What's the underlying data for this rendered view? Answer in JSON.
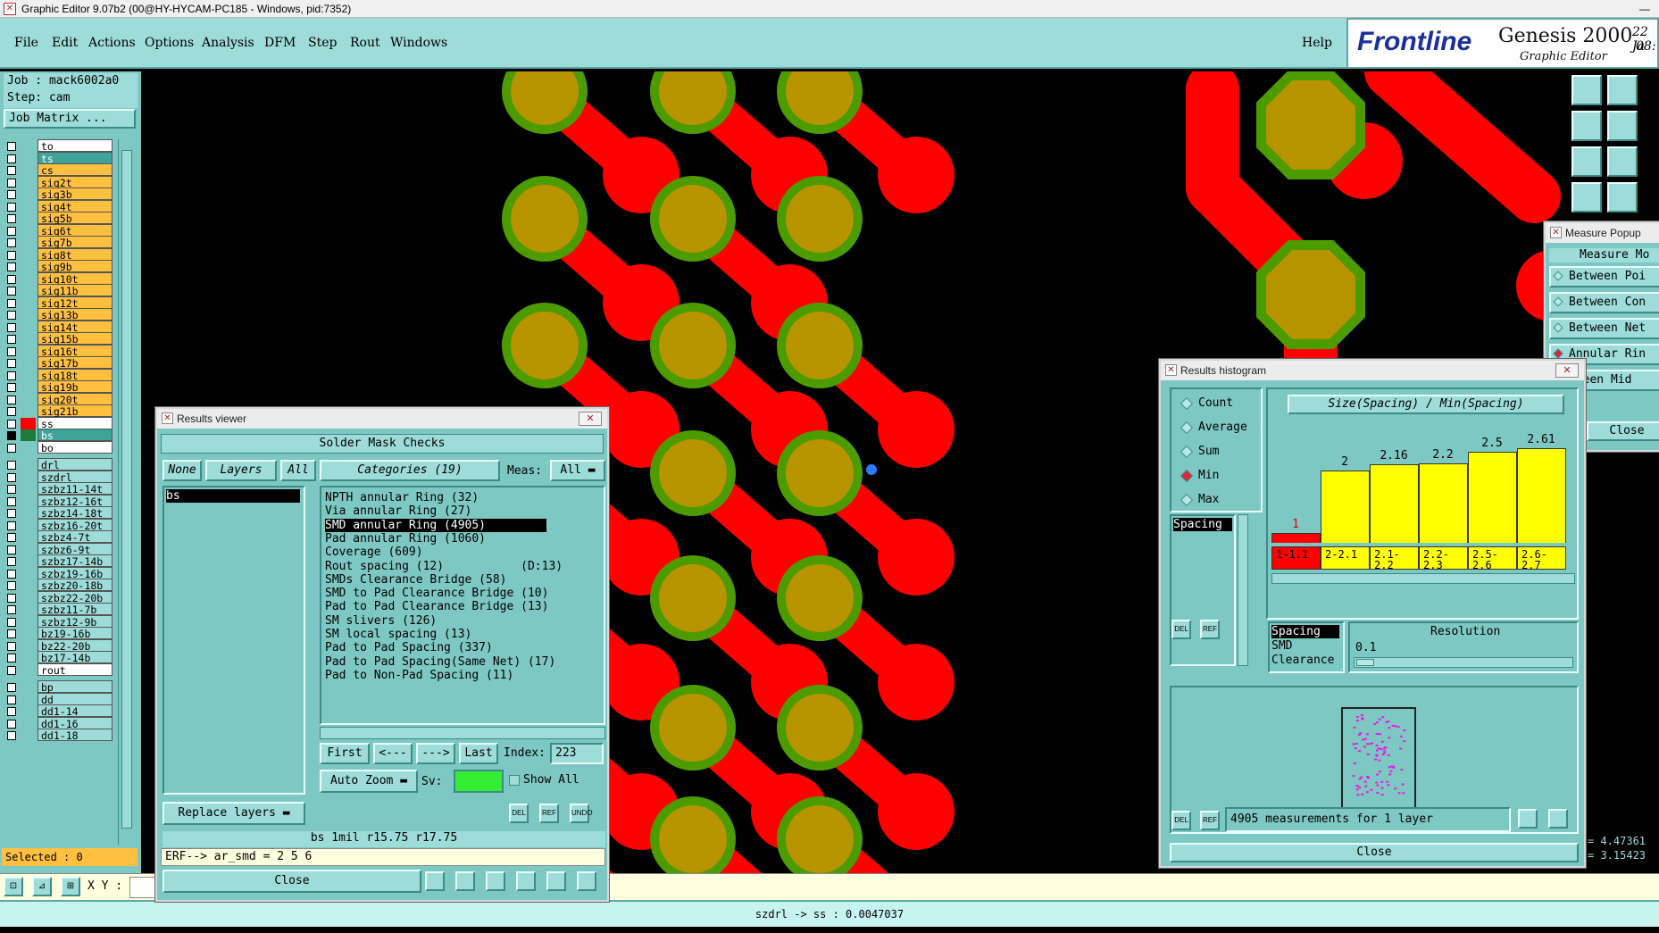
{
  "window_title": "Graphic Editor 9.07b2 (00@HY-HYCAM-PC185 - Windows, pid:7352)",
  "menu": {
    "items": [
      "File",
      "Edit",
      "Actions",
      "Options",
      "Analysis",
      "DFM",
      "Step",
      "Rout",
      "Windows"
    ],
    "help": "Help"
  },
  "logo": {
    "brand": "Frontline",
    "product": "Genesis 2000",
    "subtitle": "Graphic Editor",
    "date_partial": "22 Ja",
    "time_partial": "08:"
  },
  "left_panel": {
    "job": "Job : mack6002a0",
    "step": "Step: cam",
    "job_matrix": "Job Matrix ...",
    "selected": "Selected : 0",
    "layers_top": [
      "to",
      "ts",
      "cs",
      "sig2t",
      "sig3b",
      "sig4t",
      "sig5b",
      "sig6t",
      "sig7b",
      "sig8t",
      "sig9b",
      "sig10t",
      "sig11b",
      "sig12t",
      "sig13b",
      "sig14t",
      "sig15b",
      "sig16t",
      "sig17b",
      "sig18t",
      "sig19b",
      "sig20t",
      "sig21b",
      "ss",
      "bs",
      "bo"
    ],
    "layers_drill": [
      "drl",
      "szdrl",
      "szbz11-14t",
      "szbz12-16t",
      "szbz14-18t",
      "szbz16-20t",
      "szbz4-7t",
      "szbz6-9t",
      "szbz17-14b",
      "szbz19-16b",
      "szbz20-18b",
      "szbz22-20b",
      "szbz11-7b",
      "szbz12-9b",
      "bz19-16b",
      "bz22-20b",
      "bz17-14b",
      "rout"
    ],
    "layers_other": [
      "bp",
      "dd",
      "dd1-14",
      "dd1-16",
      "dd1-18"
    ]
  },
  "results_viewer": {
    "title": "Results viewer",
    "header": "Solder Mask Checks",
    "btn_none": "None",
    "btn_layers": "Layers",
    "btn_all": "All",
    "layer_list": [
      "bs"
    ],
    "categories_label": "Categories (19)",
    "meas_label": "Meas:",
    "meas_value": "All",
    "categories": [
      "NPTH annular Ring (32)",
      "Via annular Ring (27)",
      "SMD annular Ring (4905)",
      "Pad annular Ring (1060)",
      "Coverage (609)",
      "Rout spacing (12)           (D:13)",
      "SMDs Clearance Bridge (58)",
      "SMD to Pad Clearance Bridge (10)",
      "Pad to Pad Clearance Bridge (13)",
      "SM slivers (126)",
      "SM local spacing (13)",
      "Pad to Pad Spacing (337)",
      "Pad to Pad Spacing(Same Net) (17)",
      "Pad to Non-Pad Spacing (11)"
    ],
    "selected_category_index": 2,
    "nav": {
      "first": "First",
      "prev": "<---",
      "next": "--->",
      "last": "Last",
      "index_label": "Index:",
      "index_value": "223"
    },
    "auto_zoom": "Auto Zoom",
    "sv_label": "Sv:",
    "show_all": "Show All",
    "replace_layers": "Replace layers",
    "info_line": "bs 1mil  r15.75  r17.75",
    "erf_line": "ERF--> ar_smd = 2 5 6",
    "close": "Close",
    "icons": [
      "DEL",
      "REF",
      "UNDO"
    ]
  },
  "results_histogram": {
    "title": "Results histogram",
    "modes": [
      "Count",
      "Average",
      "Sum",
      "Min",
      "Max"
    ],
    "selected_mode": "Min",
    "measure_list": [
      "Spacing"
    ],
    "chart_title": "Size(Spacing) / Min(Spacing)",
    "resolution_label": "Resolution",
    "resolution_value": "0.1",
    "legend_list": [
      "Spacing",
      "SMD",
      "Clearance"
    ],
    "summary": "4905 measurements for 1 layer",
    "close": "Close",
    "icons": [
      "DEL",
      "REF"
    ]
  },
  "chart_data": {
    "type": "bar",
    "title": "Size(Spacing) / Min(Spacing)",
    "categories": [
      "1-1.1",
      "2-2.1",
      "2.1-2.2",
      "2.2-2.3",
      "2.5-2.6",
      "2.6-2.7"
    ],
    "values": [
      1,
      2,
      2.16,
      2.2,
      2.5,
      2.61
    ],
    "value_labels": [
      "1",
      "2",
      "2.16",
      "2.2",
      "2.5",
      "2.61"
    ],
    "colors": [
      "#ff0000",
      "#ffff00",
      "#ffff00",
      "#ffff00",
      "#ffff00",
      "#ffff00"
    ]
  },
  "measure_popup": {
    "title": "Measure Popup",
    "header": "Measure Mo",
    "items": [
      "Between Poi",
      "Between Con",
      "Between Net",
      "Annular Rin",
      "tween Mid"
    ],
    "close": "Close",
    "readout1": "= 4.47361",
    "readout2": "= 3.15423"
  },
  "xy_label": "X Y :",
  "status": "szdrl -> ss : 0.0047037",
  "colors": {
    "panel": "#7ec8c3",
    "menubar": "#9ddcd8",
    "pad_red": "#ff0000",
    "pad_gold": "#b89400",
    "ring_green": "#4c9c00"
  }
}
